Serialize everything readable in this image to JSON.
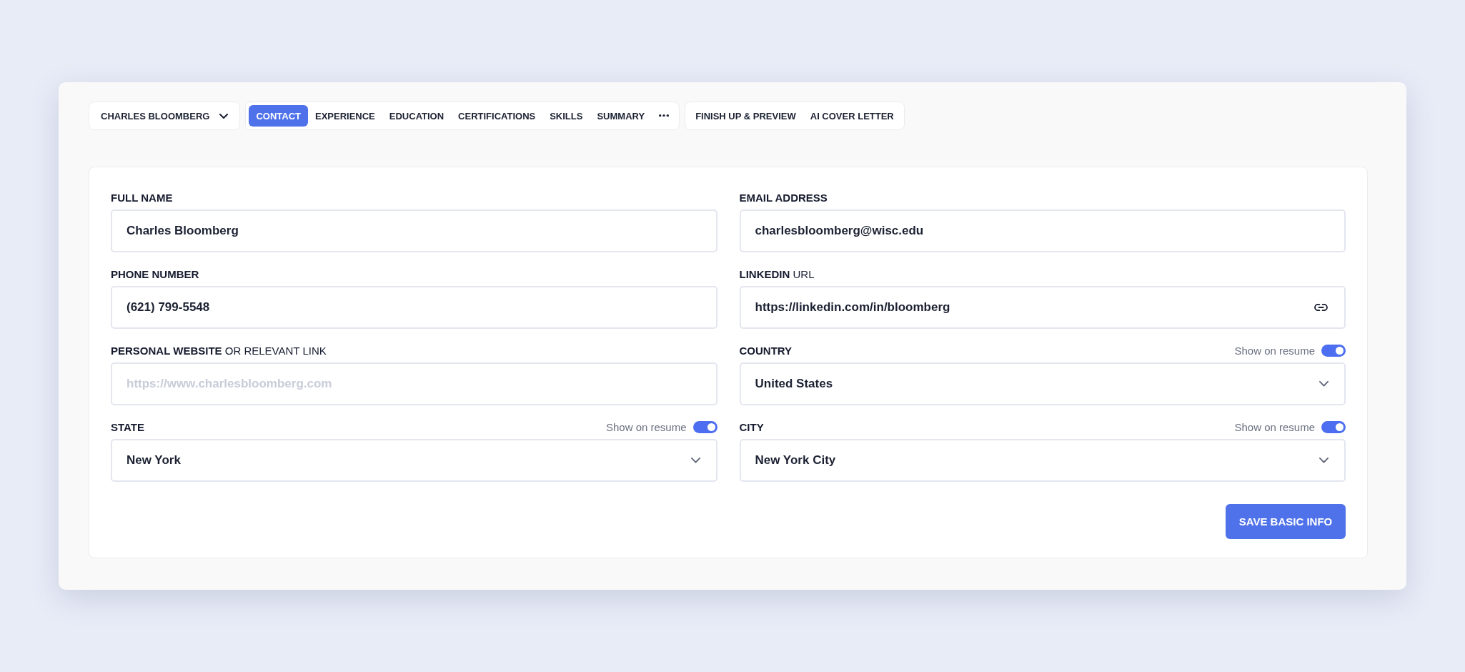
{
  "account_menu": {
    "label": "CHARLES BLOOMBERG"
  },
  "tabs": [
    {
      "label": "CONTACT",
      "selected": true
    },
    {
      "label": "EXPERIENCE",
      "selected": false
    },
    {
      "label": "EDUCATION",
      "selected": false
    },
    {
      "label": "CERTIFICATIONS",
      "selected": false
    },
    {
      "label": "SKILLS",
      "selected": false
    },
    {
      "label": "SUMMARY",
      "selected": false
    }
  ],
  "extra_links": [
    {
      "label": "FINISH UP & PREVIEW"
    },
    {
      "label": "AI COVER LETTER"
    }
  ],
  "form": {
    "fields": [
      {
        "label": "FULL NAME",
        "kind": "text",
        "value": "Charles Bloomberg"
      },
      {
        "label": "EMAIL ADDRESS",
        "kind": "text",
        "value": "charlesbloomberg@wisc.edu"
      },
      {
        "label": "PHONE NUMBER",
        "kind": "text",
        "value": "(621) 799-5548"
      },
      {
        "label": "LINKEDIN",
        "label_note": "URL",
        "kind": "link",
        "value": "https://linkedin.com/in/bloomberg"
      },
      {
        "label": "PERSONAL WEBSITE",
        "label_note": "OR RELEVANT LINK",
        "kind": "text",
        "placeholder": "https://www.charlesbloomberg.com"
      },
      {
        "label": "COUNTRY",
        "kind": "select",
        "value": "United States",
        "resume_toggle": {
          "label": "Show on resume",
          "on": true
        }
      },
      {
        "label": "STATE",
        "kind": "select",
        "value": "New York",
        "resume_toggle": {
          "label": "Show on resume",
          "on": true
        }
      },
      {
        "label": "CITY",
        "kind": "select",
        "value": "New York City",
        "resume_toggle": {
          "label": "Show on resume",
          "on": true
        }
      }
    ],
    "save_button": {
      "label": "SAVE BASIC INFO"
    }
  }
}
